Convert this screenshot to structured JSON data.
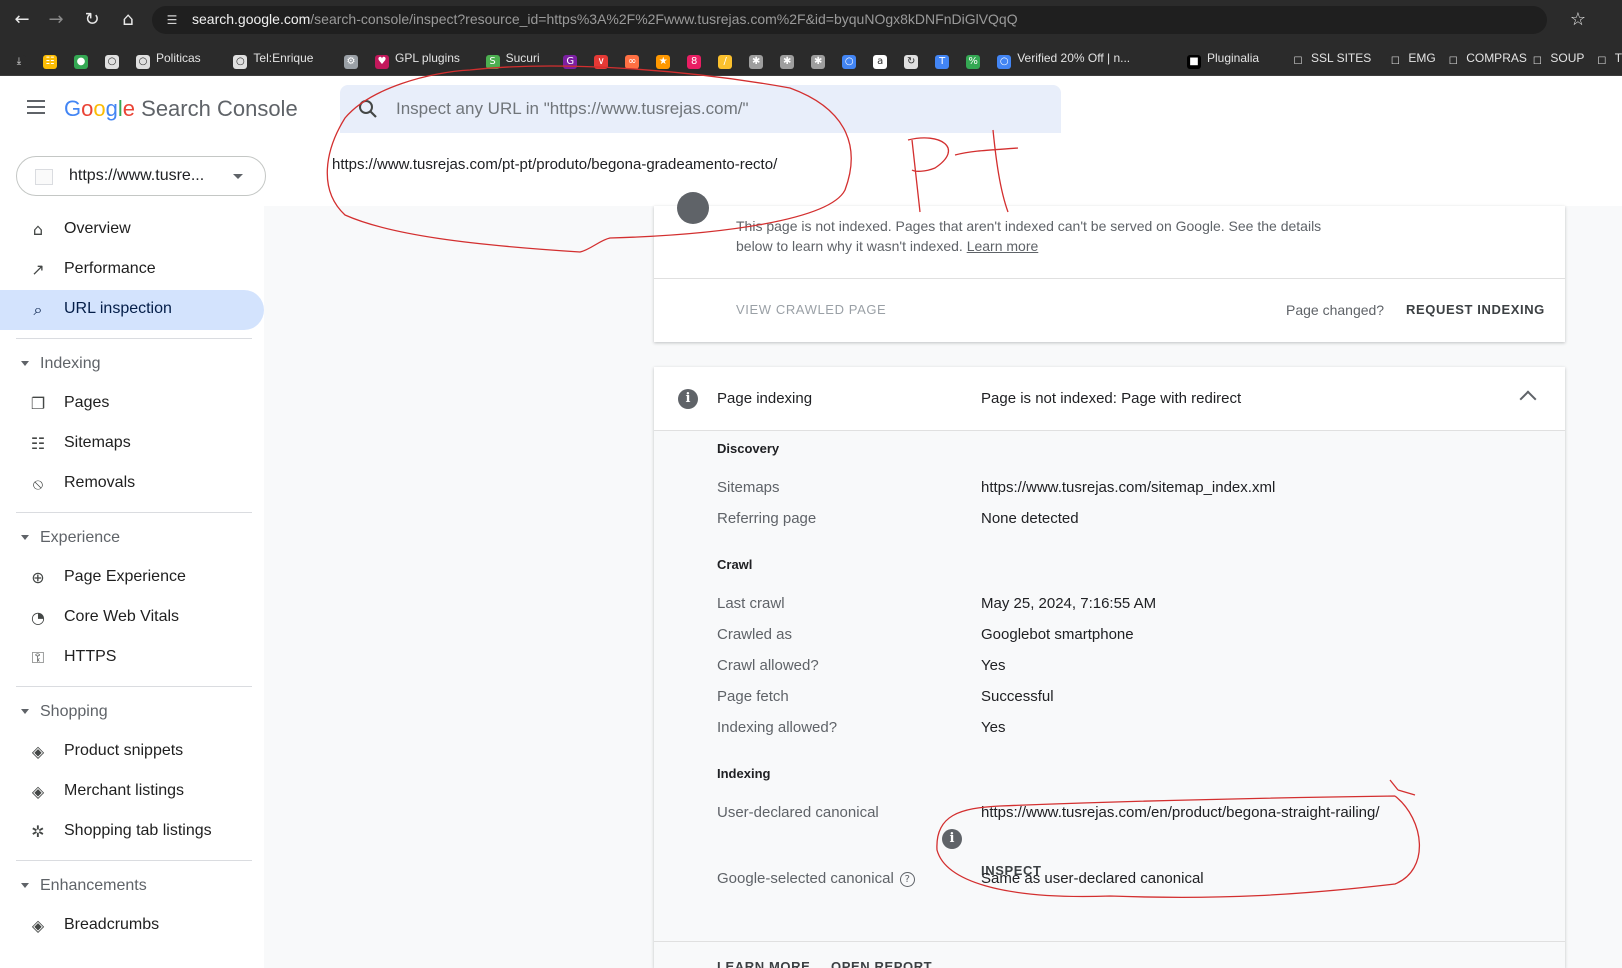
{
  "browser": {
    "url_host": "search.google.com",
    "url_path": "/search-console/inspect?resource_id=https%3A%2F%2Fwww.tusrejas.com%2F&id=byquNOgx8kDNFnDiGlVQqQ",
    "bookmarks": [
      {
        "label": "",
        "icon": "download-icon",
        "color": "#2b2b2b"
      },
      {
        "label": "",
        "icon": "apps-grid-icon",
        "color": "#fbbc05"
      },
      {
        "label": "",
        "icon": "chrome-icon",
        "color": "#34a853"
      },
      {
        "label": "",
        "icon": "globe-icon",
        "color": "#e0e0e0"
      },
      {
        "label": "Politicas",
        "icon": "globe-icon",
        "color": "#e0e0e0"
      },
      {
        "label": "Tel:Enrique",
        "icon": "globe-icon",
        "color": "#e0e0e0"
      },
      {
        "label": "",
        "icon": "tool-icon",
        "color": "#9aa0a6"
      },
      {
        "label": "GPL plugins",
        "icon": "heart-icon",
        "color": "#c2185b"
      },
      {
        "label": "Sucuri",
        "icon": "sucuri-icon",
        "color": "#4caf50"
      },
      {
        "label": "",
        "icon": "g-icon",
        "color": "#7b1fa2"
      },
      {
        "label": "",
        "icon": "pocket-icon",
        "color": "#e53935"
      },
      {
        "label": "",
        "icon": "link-icon",
        "color": "#ff7043"
      },
      {
        "label": "",
        "icon": "fox-icon",
        "color": "#ff9800"
      },
      {
        "label": "",
        "icon": "b-icon",
        "color": "#e91e63"
      },
      {
        "label": "",
        "icon": "slash-icon",
        "color": "#fbc02d"
      },
      {
        "label": "",
        "icon": "wp-icon",
        "color": "#9e9e9e"
      },
      {
        "label": "",
        "icon": "wp-icon",
        "color": "#9e9e9e"
      },
      {
        "label": "",
        "icon": "wp-icon",
        "color": "#9e9e9e"
      },
      {
        "label": "",
        "icon": "globe-icon",
        "color": "#4285f4"
      },
      {
        "label": "",
        "icon": "amazon-icon",
        "color": "#ffffff"
      },
      {
        "label": "",
        "icon": "refresh-icon",
        "color": "#e0e0e0"
      },
      {
        "label": "",
        "icon": "t-icon",
        "color": "#4285f4"
      },
      {
        "label": "",
        "icon": "percent-icon",
        "color": "#34a853"
      },
      {
        "label": "Verified 20% Off | n...",
        "icon": "globe-icon",
        "color": "#4285f4"
      },
      {
        "label": "Pluginalia",
        "icon": "pluginalia-icon",
        "color": "#000000"
      },
      {
        "label": "SSL SITES",
        "icon": "folder-icon",
        "color": "#2b2b2b"
      },
      {
        "label": "EMG",
        "icon": "folder-icon",
        "color": "#2b2b2b"
      },
      {
        "label": "COMPRAS",
        "icon": "folder-icon",
        "color": "#2b2b2b"
      },
      {
        "label": "SOUP",
        "icon": "folder-icon",
        "color": "#2b2b2b"
      },
      {
        "label": "TV",
        "icon": "folder-icon",
        "color": "#2b2b2b"
      },
      {
        "label": "",
        "icon": "folder-icon",
        "color": "#2b2b2b"
      }
    ]
  },
  "header": {
    "product_name": "Search Console",
    "logo": "Google",
    "search": {
      "placeholder": "Inspect any URL in \"https://www.tusrejas.com/\"",
      "suggestion": "https://www.tusrejas.com/pt-pt/produto/begona-gradeamento-recto/"
    },
    "property": "https://www.tusre..."
  },
  "sidebar": {
    "items": [
      {
        "label": "Overview",
        "icon": "home-icon",
        "active": false
      },
      {
        "label": "Performance",
        "icon": "trending-up-icon",
        "active": false
      },
      {
        "label": "URL inspection",
        "icon": "search-icon",
        "active": true
      }
    ],
    "sections": [
      {
        "title": "Indexing",
        "items": [
          {
            "label": "Pages",
            "icon": "pages-icon"
          },
          {
            "label": "Sitemaps",
            "icon": "sitemap-icon"
          },
          {
            "label": "Removals",
            "icon": "visibility-off-icon"
          }
        ]
      },
      {
        "title": "Experience",
        "items": [
          {
            "label": "Page Experience",
            "icon": "add-circle-icon"
          },
          {
            "label": "Core Web Vitals",
            "icon": "speed-icon"
          },
          {
            "label": "HTTPS",
            "icon": "lock-icon"
          }
        ]
      },
      {
        "title": "Shopping",
        "items": [
          {
            "label": "Product snippets",
            "icon": "layers-icon"
          },
          {
            "label": "Merchant listings",
            "icon": "layers-icon"
          },
          {
            "label": "Shopping tab listings",
            "icon": "tag-icon"
          }
        ]
      },
      {
        "title": "Enhancements",
        "items": [
          {
            "label": "Breadcrumbs",
            "icon": "layers-icon"
          }
        ]
      }
    ]
  },
  "status_card": {
    "description": "This page is not indexed. Pages that aren't indexed can't be served on Google. See the details below to learn why it wasn't indexed.",
    "learn_more": "Learn more",
    "view_crawled": "VIEW CRAWLED PAGE",
    "page_changed": "Page changed?",
    "request_indexing": "REQUEST INDEXING"
  },
  "index_card": {
    "title": "Page indexing",
    "verdict": "Page is not indexed: Page with redirect",
    "discovery": {
      "heading": "Discovery",
      "rows": [
        {
          "label": "Sitemaps",
          "value": "https://www.tusrejas.com/sitemap_index.xml"
        },
        {
          "label": "Referring page",
          "value": "None detected"
        }
      ]
    },
    "crawl": {
      "heading": "Crawl",
      "rows": [
        {
          "label": "Last crawl",
          "value": "May 25, 2024, 7:16:55 AM"
        },
        {
          "label": "Crawled as",
          "value": "Googlebot smartphone"
        },
        {
          "label": "Crawl allowed?",
          "value": "Yes"
        },
        {
          "label": "Page fetch",
          "value": "Successful"
        },
        {
          "label": "Indexing allowed?",
          "value": "Yes"
        }
      ]
    },
    "indexing": {
      "heading": "Indexing",
      "user_canonical_label": "User-declared canonical",
      "user_canonical_value": "https://www.tusrejas.com/en/product/begona-straight-railing/",
      "inspect": "INSPECT",
      "google_canonical_label": "Google-selected canonical",
      "google_canonical_value": "Same as user-declared canonical"
    },
    "learn_more": "LEARN MORE",
    "open_report": "OPEN REPORT"
  },
  "annotations": {
    "handwritten_text": "PT",
    "color": "#d32f2f"
  }
}
